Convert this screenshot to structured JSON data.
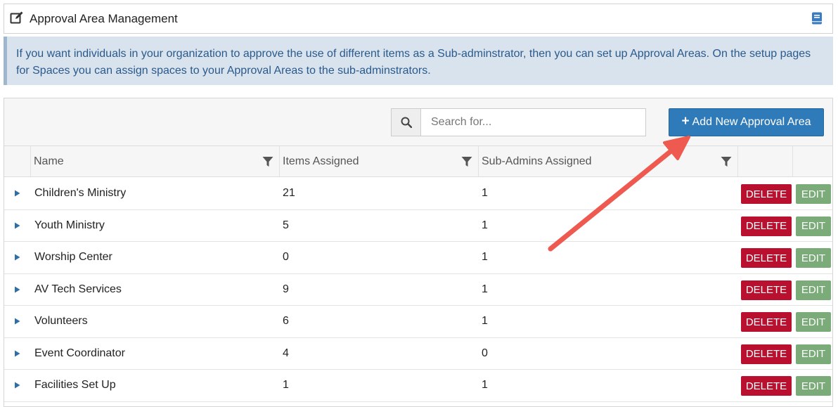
{
  "header": {
    "title": "Approval Area Management",
    "edit_icon": "edit-square-icon",
    "help_icon": "book-icon"
  },
  "info": {
    "text": "If you want individuals in your organization to approve the use of different items as a Sub-adminstrator, then you can set up Approval Areas.  On the setup pages for Spaces you can assign spaces to your Approval Areas to the sub-adminstrators."
  },
  "toolbar": {
    "search_placeholder": "Search for...",
    "search_value": "",
    "add_label": "Add New Approval Area"
  },
  "columns": [
    "Name",
    "Items Assigned",
    "Sub-Admins Assigned"
  ],
  "rows": [
    {
      "name": "Children's Ministry",
      "items": "21",
      "subs": "1"
    },
    {
      "name": "Youth Ministry",
      "items": "5",
      "subs": "1"
    },
    {
      "name": "Worship Center",
      "items": "0",
      "subs": "1"
    },
    {
      "name": "AV Tech Services",
      "items": "9",
      "subs": "1"
    },
    {
      "name": "Volunteers",
      "items": "6",
      "subs": "1"
    },
    {
      "name": "Event Coordinator",
      "items": "4",
      "subs": "0"
    },
    {
      "name": "Facilities Set Up",
      "items": "1",
      "subs": "1"
    }
  ],
  "row_actions": {
    "delete_label": "DELETE",
    "edit_label": "EDIT"
  },
  "colors": {
    "primary": "#2f7ab8",
    "delete": "#b8102e",
    "edit": "#7aab79",
    "info_bg": "#d9e3ee",
    "info_text": "#2a5a8c",
    "annotation_arrow": "#ee5a4f"
  }
}
